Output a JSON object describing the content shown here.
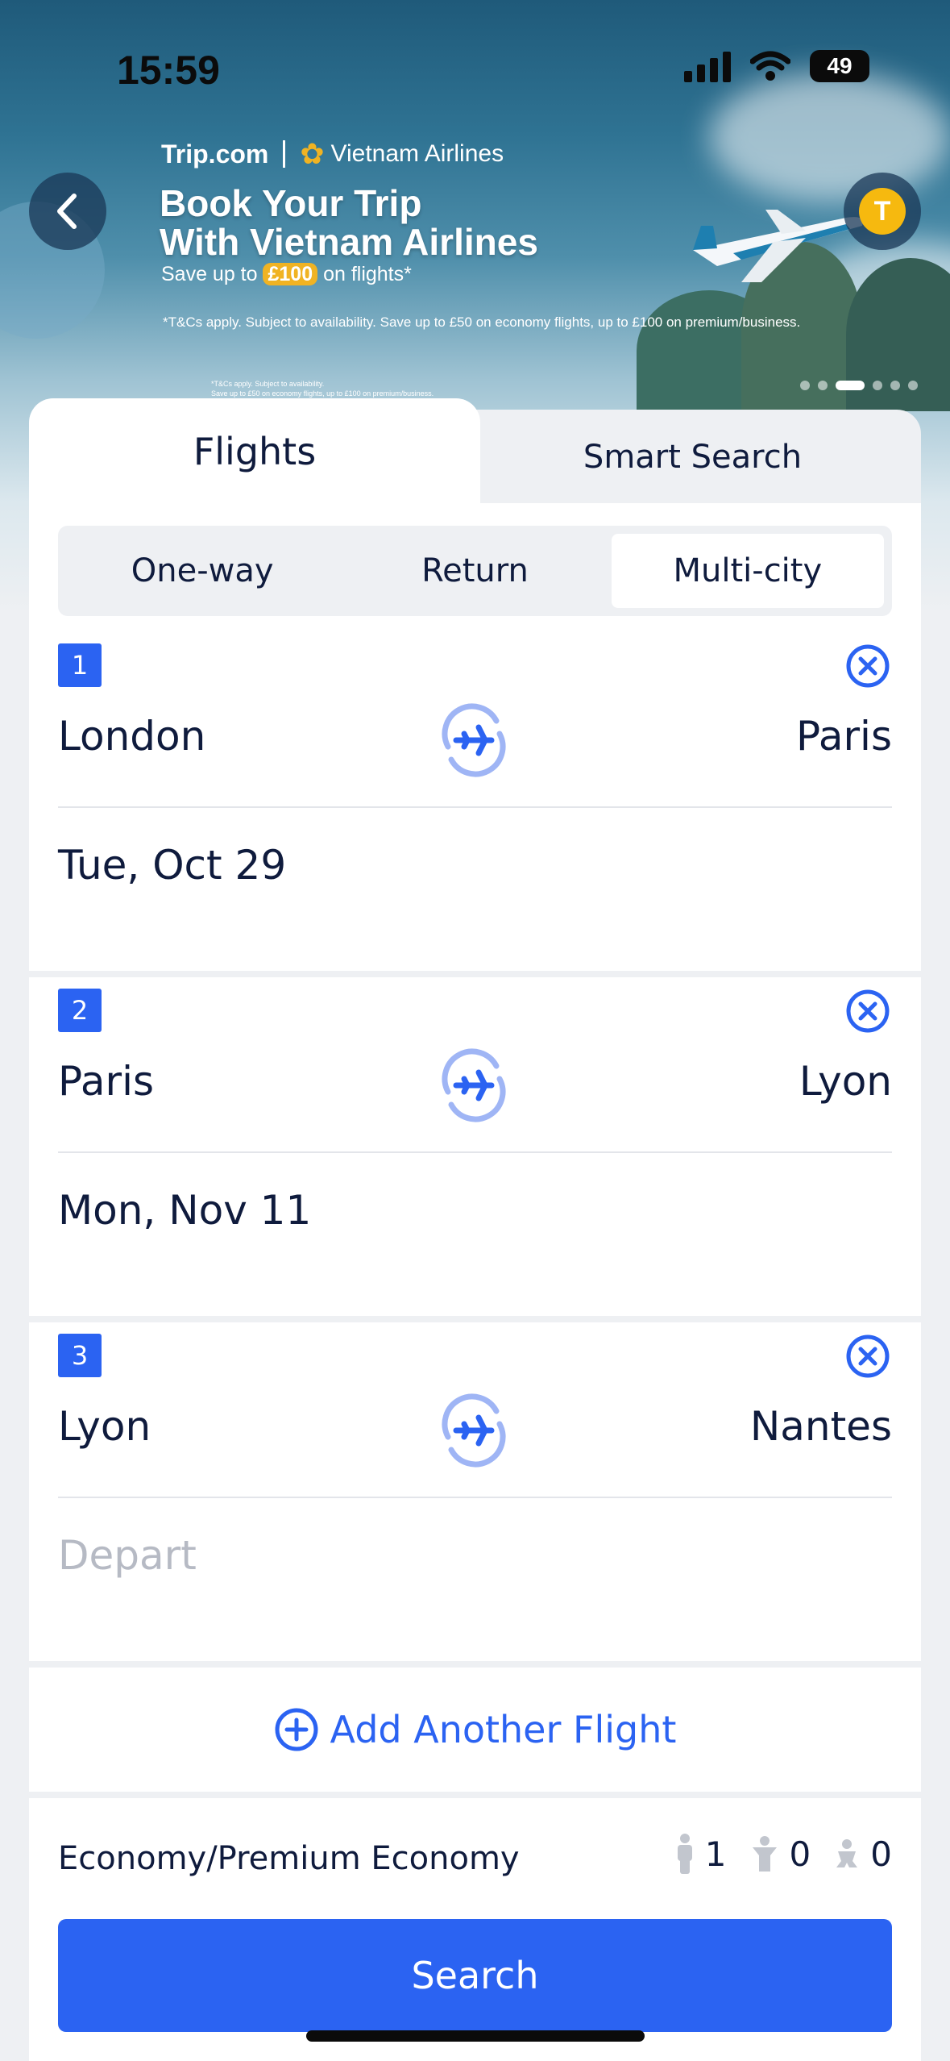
{
  "status_bar": {
    "time": "15:59",
    "battery": "49"
  },
  "banner": {
    "brand": "Trip.com",
    "partner": "Vietnam Airlines",
    "title_line1": "Book Your Trip",
    "title_line2": "With Vietnam Airlines",
    "subtitle_prefix": "Save up to",
    "subtitle_amount": "£100",
    "subtitle_suffix": "on flights*",
    "terms": "*T&Cs apply. Subject to availability. Save up to £50 on economy flights, up to £100 on premium/business.",
    "terms_small_1": "*T&Cs apply. Subject to availability.",
    "terms_small_2": "Save up to £50 on economy flights, up to £100 on premium/business.",
    "avatar_initial": "T"
  },
  "tabs": {
    "flights": "Flights",
    "smart_search": "Smart Search"
  },
  "trip_types": [
    "One-way",
    "Return",
    "Multi-city"
  ],
  "selected_trip_type": "Multi-city",
  "segments": [
    {
      "number": "1",
      "from": "London",
      "to": "Paris",
      "date": "Tue, Oct 29"
    },
    {
      "number": "2",
      "from": "Paris",
      "to": "Lyon",
      "date": "Mon, Nov 11"
    },
    {
      "number": "3",
      "from": "Lyon",
      "to": "Nantes",
      "date_placeholder": "Depart"
    }
  ],
  "add_flight_label": "Add Another Flight",
  "cabin_class": "Economy/Premium Economy",
  "passengers": {
    "adults": "1",
    "children": "0",
    "infants": "0"
  },
  "search_label": "Search",
  "colors": {
    "accent": "#2b63f2",
    "text": "#0f1b3d",
    "placeholder": "#b6bac4"
  }
}
